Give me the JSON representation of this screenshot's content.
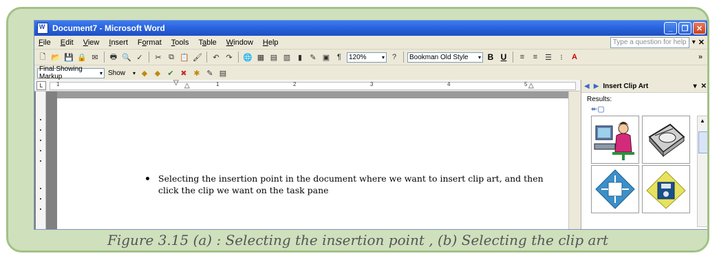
{
  "window": {
    "title": "Document7 - Microsoft Word",
    "buttons": [
      "_",
      "❐",
      "✕"
    ]
  },
  "menu": {
    "items": [
      {
        "label": "File"
      },
      {
        "label": "Edit"
      },
      {
        "label": "View"
      },
      {
        "label": "Insert"
      },
      {
        "label": "Format"
      },
      {
        "label": "Tools"
      },
      {
        "label": "Table"
      },
      {
        "label": "Window"
      },
      {
        "label": "Help"
      }
    ],
    "ask_placeholder": "Type a question for help"
  },
  "standard_toolbar": {
    "zoom": "120%",
    "font": "Bookman Old Style",
    "bold": "B",
    "underline": "U",
    "more": "»"
  },
  "review_toolbar": {
    "markup": "Final Showing Markup",
    "show": "Show"
  },
  "ruler": {
    "ticks": [
      "1",
      "2",
      "3",
      "4",
      "5"
    ]
  },
  "document": {
    "bullet_text": "Selecting the insertion point in the document where we want to insert clip art, and then click the clip we want on the task pane"
  },
  "task_pane": {
    "title": "Insert Clip Art",
    "results_label": "Results:",
    "clips": [
      "person-at-computer-clip",
      "disk-drive-clip",
      "circuit-chip-clip",
      "floppy-disk-clip"
    ]
  },
  "caption": "Figure 3.15 (a) : Selecting the insertion point , (b) Selecting the clip art"
}
